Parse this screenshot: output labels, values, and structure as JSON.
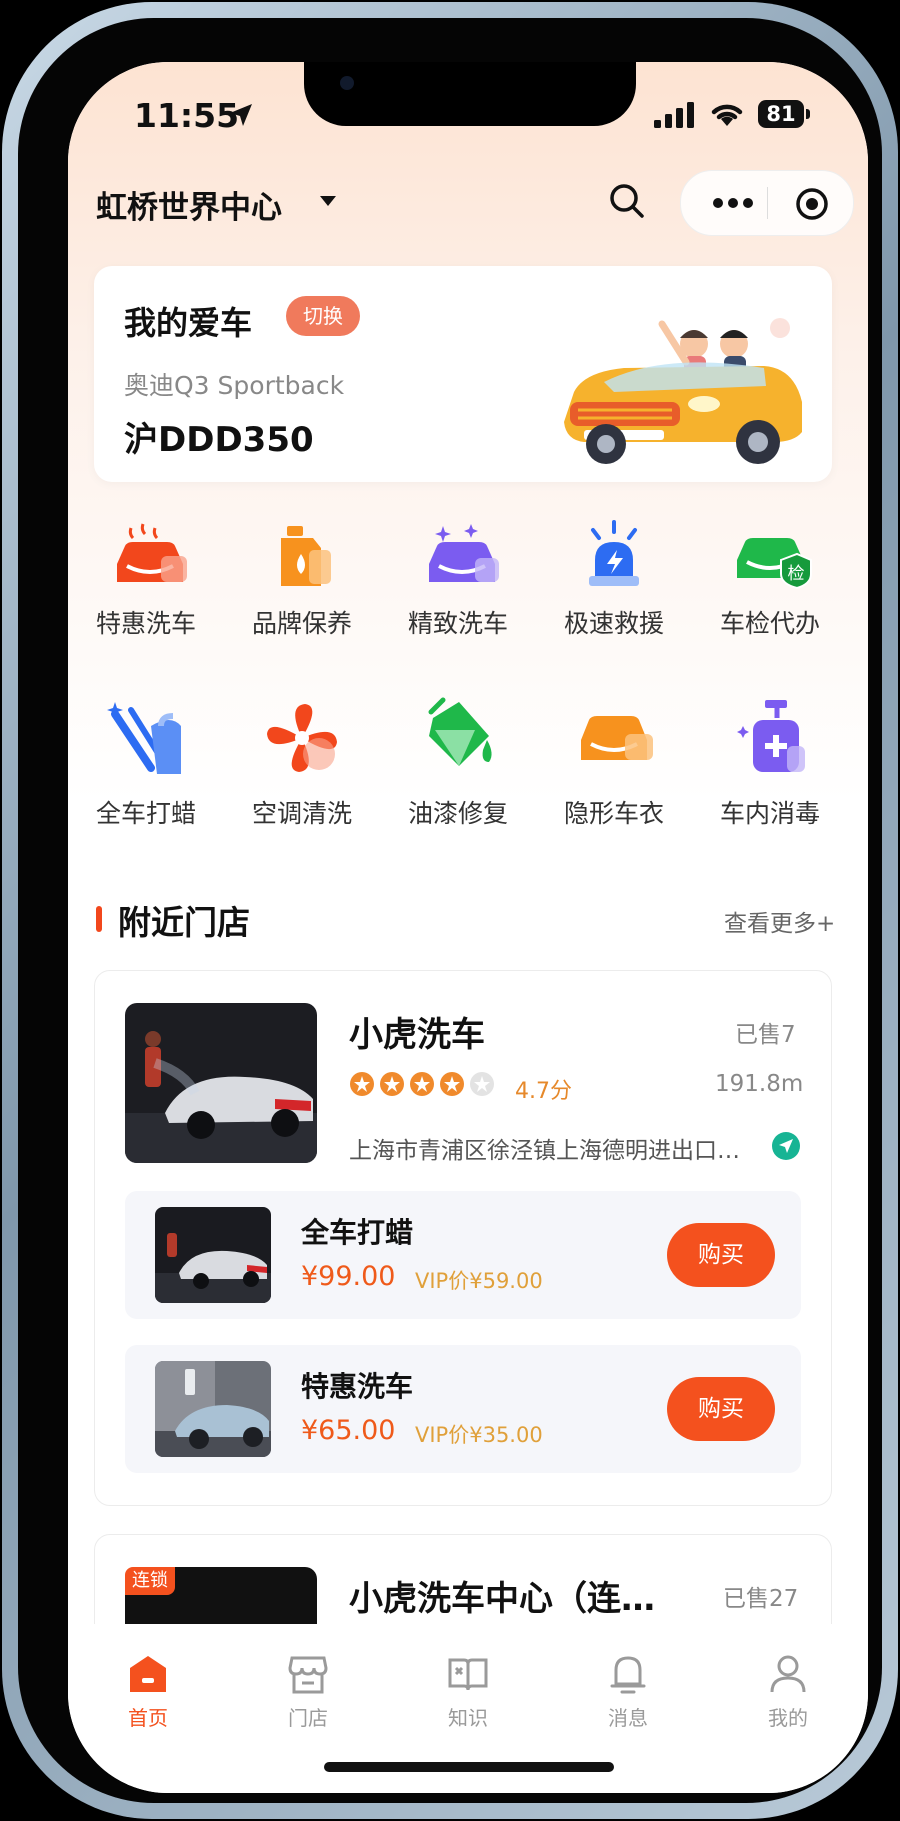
{
  "status": {
    "time": "11:55",
    "battery": "81"
  },
  "header": {
    "location": "虹桥世界中心"
  },
  "car_card": {
    "title": "我的爱车",
    "switch_label": "切换",
    "model": "奥迪Q3 Sportback",
    "plate": "沪DDD350"
  },
  "services": [
    {
      "label": "特惠洗车",
      "icon": "car-wash-icon"
    },
    {
      "label": "品牌保养",
      "icon": "oil-can-icon"
    },
    {
      "label": "精致洗车",
      "icon": "sparkle-car-icon"
    },
    {
      "label": "极速救援",
      "icon": "siren-icon"
    },
    {
      "label": "车检代办",
      "icon": "inspection-car-icon"
    },
    {
      "label": "全车打蜡",
      "icon": "wax-spray-icon"
    },
    {
      "label": "空调清洗",
      "icon": "fan-icon"
    },
    {
      "label": "油漆修复",
      "icon": "paint-bucket-icon"
    },
    {
      "label": "隐形车衣",
      "icon": "car-cover-icon"
    },
    {
      "label": "车内消毒",
      "icon": "sanitizer-icon"
    }
  ],
  "inspection_badge": "检",
  "nearby": {
    "title": "附近门店",
    "more": "查看更多+"
  },
  "store": {
    "name": "小虎洗车",
    "sold": "已售7",
    "rating": "4.7分",
    "rating_value": 4.7,
    "distance": "191.8m",
    "address": "上海市青浦区徐泾镇上海德明进出口有限公司",
    "items": [
      {
        "name": "全车打蜡",
        "price": "¥99.00",
        "vip": "VIP价¥59.00",
        "button": "购买"
      },
      {
        "name": "特惠洗车",
        "price": "¥65.00",
        "vip": "VIP价¥35.00",
        "button": "购买"
      }
    ]
  },
  "store2": {
    "badge": "连锁",
    "name": "小虎洗车中心（连…",
    "sold": "已售27"
  },
  "tabbar": [
    {
      "label": "首页",
      "active": true
    },
    {
      "label": "门店",
      "active": false
    },
    {
      "label": "知识",
      "active": false
    },
    {
      "label": "消息",
      "active": false
    },
    {
      "label": "我的",
      "active": false
    }
  ],
  "colors": {
    "accent": "#f4511e",
    "vip": "#e0a03a",
    "star": "#f08a2c"
  }
}
